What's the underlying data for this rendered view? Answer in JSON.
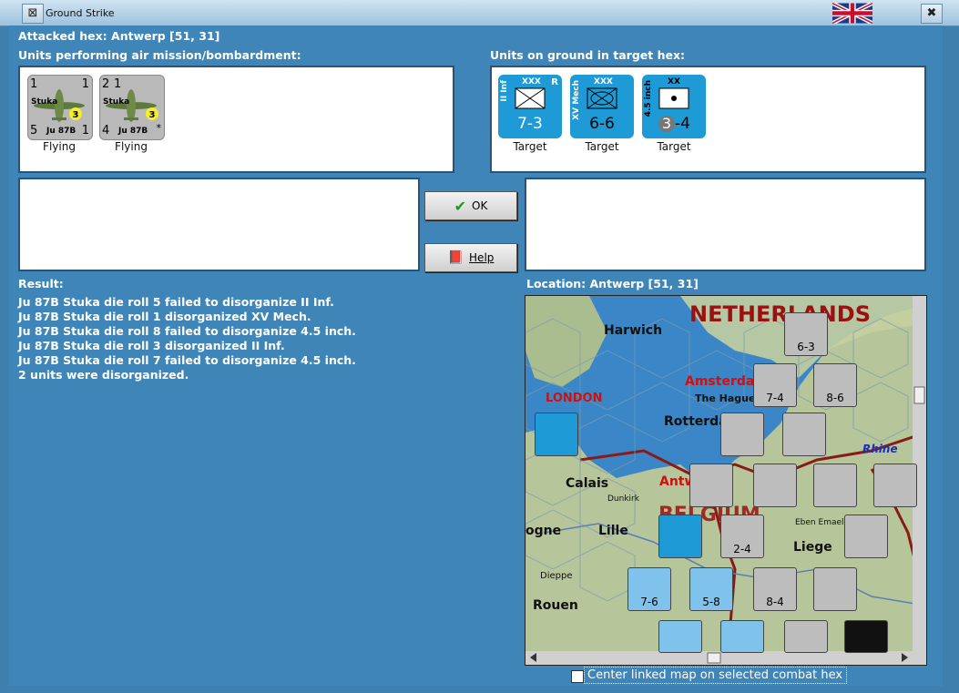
{
  "window": {
    "title": "Ground Strike"
  },
  "header": {
    "attacked_hex": "Attacked hex: Antwerp  [51, 31]"
  },
  "air_panel": {
    "label": "Units performing air mission/bombardment:",
    "units": [
      {
        "name": "Stuka",
        "model": "Ju 87B",
        "top_left": "1",
        "top_right": "1",
        "bottom_left": "5",
        "bottom_right": "1",
        "badge": "3",
        "status": "Flying"
      },
      {
        "name": "Stuka",
        "model": "Ju 87B",
        "top_left": "2",
        "top_right": "1",
        "bottom_left": "4",
        "bottom_right": "*",
        "badge": "3",
        "status": "Flying"
      }
    ]
  },
  "ground_panel": {
    "label": "Units on ground in target hex:",
    "units": [
      {
        "side": "II Inf",
        "size": "XXX",
        "flag": "R",
        "strength": "7-3",
        "status": "Target"
      },
      {
        "side": "XV Mech",
        "size": "XXX",
        "flag": "",
        "strength": "6-6",
        "status": "Target"
      },
      {
        "side": "4.5 inch",
        "size": "XX",
        "flag": "",
        "strength_a": "3",
        "strength_b": "-4",
        "status": "Target"
      }
    ]
  },
  "buttons": {
    "ok": "OK",
    "help": "Help"
  },
  "result": {
    "label": "Result:",
    "lines": [
      "Ju 87B Stuka die roll 5 failed to disorganize II Inf.",
      "Ju 87B Stuka die roll 1 disorganized XV Mech.",
      "Ju 87B Stuka die roll 8 failed to disorganize 4.5 inch.",
      "Ju 87B Stuka die roll 3 disorganized II Inf.",
      "Ju 87B Stuka die roll 7 failed to disorganize 4.5 inch.",
      "2 units were disorganized."
    ]
  },
  "location": {
    "label": "Location:  Antwerp  [51, 31]",
    "map_labels": {
      "netherlands": "NETHERLANDS",
      "harwich": "Harwich",
      "amsterdam": "Amsterdam",
      "the_hague": "The Hague",
      "rotterdam": "Rotterdam",
      "london": "LONDON",
      "calais": "Calais",
      "dunkirk": "Dunkirk",
      "antwerp": "Antw",
      "belgium": "BELGIUM",
      "lille": "Lille",
      "liege": "Liege",
      "dieppe": "Dieppe",
      "rouen": "Rouen",
      "rhine": "Rhine",
      "eben_emael": "Eben Emael",
      "boulogne": "ogne"
    },
    "map_counters": [
      {
        "label": "6-3"
      },
      {
        "label": "7-4"
      },
      {
        "label": "8-6"
      },
      {
        "label": "2-4"
      },
      {
        "label": "7-6"
      },
      {
        "label": "5-8"
      },
      {
        "label": "8-4"
      }
    ]
  },
  "options": {
    "center_linked": "Center linked map on selected combat hex"
  },
  "colors": {
    "background": "#3f85b8",
    "unit_blue": "#1e9ad6",
    "map_sea": "#3a86c6"
  }
}
